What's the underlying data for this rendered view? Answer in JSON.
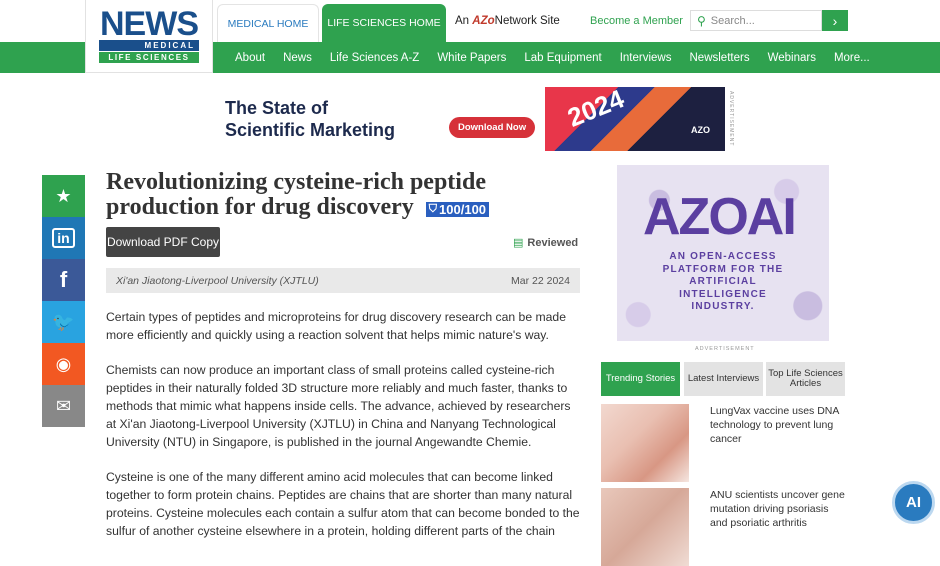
{
  "logo": {
    "news": "NEWS",
    "medical": "MEDICAL",
    "life": "LIFE SCIENCES"
  },
  "top": {
    "tab_medical": "MEDICAL HOME",
    "tab_life": "LIFE SCIENCES HOME",
    "network_prefix": "An",
    "network_brand": "AZo",
    "network_suffix": "Network Site",
    "member": "Become a Member",
    "search_placeholder": "Search...",
    "search_icon": "search-icon"
  },
  "nav": [
    "About",
    "News",
    "Life Sciences A-Z",
    "White Papers",
    "Lab Equipment",
    "Interviews",
    "Newsletters",
    "Webinars",
    "More..."
  ],
  "banner": {
    "line1": "The State of",
    "line2": "Scientific Marketing",
    "button": "Download Now",
    "year": "2024",
    "brand": "AZO",
    "ad_label": "ADVERTISEMENT"
  },
  "share": {
    "items": [
      {
        "icon": "star-icon",
        "glyph": "★",
        "color": "#2fa24f"
      },
      {
        "icon": "linkedin-icon",
        "glyph": "in",
        "color": "#1f77b5"
      },
      {
        "icon": "facebook-icon",
        "glyph": "f",
        "color": "#3b5998"
      },
      {
        "icon": "twitter-icon",
        "glyph": "🐦",
        "color": "#29a3e0"
      },
      {
        "icon": "reddit-icon",
        "glyph": "◉",
        "color": "#f25822"
      },
      {
        "icon": "email-icon",
        "glyph": "✉",
        "color": "#888888"
      }
    ]
  },
  "article": {
    "title": "Revolutionizing cysteine-rich peptide production for drug discovery",
    "score": "100/100",
    "download": "Download PDF Copy",
    "reviewed": "Reviewed",
    "source": "Xi'an Jiaotong-Liverpool University (XJTLU)",
    "date": "Mar 22 2024",
    "paragraphs": [
      "Certain types of peptides and microproteins for drug discovery research can be made more efficiently and quickly using a reaction solvent that helps mimic nature's way.",
      "Chemists can now produce an important class of small proteins called cysteine-rich peptides in their naturally folded 3D structure more reliably and much faster, thanks to methods that mimic what happens inside cells. The advance, achieved by researchers at Xi'an Jiaotong-Liverpool University (XJTLU) in China and Nanyang Technological University (NTU) in Singapore, is published in the journal Angewandte Chemie.",
      "Cysteine is one of the many different amino acid molecules that can become linked together to form protein chains. Peptides are chains that are shorter than many natural proteins. Cysteine molecules each contain a sulfur atom that can become bonded to the sulfur of another cysteine elsewhere in a protein, holding different parts of the chain"
    ]
  },
  "sidebar": {
    "ad": {
      "brand": "AZOAI",
      "text": "AN OPEN-ACCESS PLATFORM FOR THE ARTIFICIAL INTELLIGENCE INDUSTRY."
    },
    "ad_label": "ADVERTISEMENT",
    "tabs": [
      "Trending Stories",
      "Latest Interviews",
      "Top Life Sciences Articles"
    ],
    "news": [
      "LungVax vaccine uses DNA technology to prevent lung cancer",
      "ANU scientists uncover gene mutation driving psoriasis and psoriatic arthritis"
    ]
  },
  "ai_button": "AI"
}
